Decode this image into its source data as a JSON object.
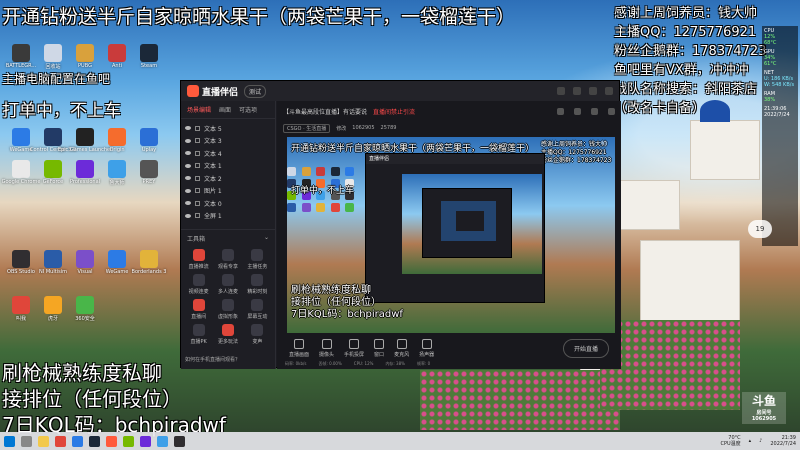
{
  "overlay": {
    "headline": "开通钻粉送半斤自家晾晒水果干（两袋芒果干，一袋榴莲干）",
    "thanks_lines": [
      "感谢上周饲养员：钱大帅",
      "主播QQ：1275776921",
      "粉丝企鹅群：178374723",
      "鱼吧里有VX群，冲冲冲",
      "战队名称搜索：斜阳茶店",
      "（改名卡自备）"
    ],
    "config_note": "主播电脑配置在鱼吧",
    "order_status": "打单中，不上车",
    "bottom_lines": [
      "刷枪械熟练度私聊",
      "接排位（任何段位）",
      "7日KQL码：bchpiradwf"
    ]
  },
  "desktop_icons": [
    {
      "label": "BATTLEGR...",
      "color": "#3a3a3a"
    },
    {
      "label": "回收站",
      "color": "#cfd8e6"
    },
    {
      "label": "PUBG",
      "color": "#d9a13c"
    },
    {
      "label": "Anti",
      "color": "#c93b3b"
    },
    {
      "label": "Steam",
      "color": "#1b2838"
    },
    {
      "label": "WeGame",
      "color": "#2c7be5"
    },
    {
      "label": "Control Center 3.0",
      "color": "#223a66"
    },
    {
      "label": "Epic Games Launcher",
      "color": "#222"
    },
    {
      "label": "Origin",
      "color": "#f56c2d"
    },
    {
      "label": "Uplay",
      "color": "#2b6fd6"
    },
    {
      "label": "Google Chrome",
      "color": "#e9e9e9"
    },
    {
      "label": "GeForce",
      "color": "#76b900"
    },
    {
      "label": "Professional",
      "color": "#6c2bd9"
    },
    {
      "label": "鲁大师",
      "color": "#3ea0e8"
    },
    {
      "label": "PREY",
      "color": "#555"
    },
    {
      "label": "OBS Studio",
      "color": "#302e31"
    },
    {
      "label": "NI Multisim",
      "color": "#2a5ca8"
    },
    {
      "label": "Visual",
      "color": "#7b4fc9"
    },
    {
      "label": "WeGame",
      "color": "#2c7be5"
    },
    {
      "label": "Borderlands 3",
      "color": "#e2b33a"
    },
    {
      "label": "叫我",
      "color": "#e0463a"
    },
    {
      "label": "虎牙",
      "color": "#f5a623"
    },
    {
      "label": "360安全",
      "color": "#49b649"
    }
  ],
  "app": {
    "name": "直播伴侣",
    "version_badge": "测试",
    "tabs": [
      "场景编辑",
      "画面",
      "可选项"
    ],
    "scenes": [
      "文本 5",
      "文本 3",
      "文本 4",
      "文本 1",
      "文本 2",
      "图片 1",
      "文本 0",
      "全屏 1"
    ],
    "tools_title": "工具箱",
    "tools": [
      "直播推流",
      "观看专享",
      "主播任务",
      "视频连麦",
      "多人连麦",
      "精彩时刻",
      "直播间",
      "虚拟形象",
      "屏幕互动",
      "直播PK",
      "更多玩法",
      "变声"
    ],
    "bottom_note": "如何在手机直播间观看？",
    "room_title": "【斗鱼最高段位直播】有话要说",
    "room_prefix": "有话要说",
    "room_tag": "直播间禁止引流",
    "room_meta": [
      "CSGO · 生活直播",
      "修改",
      "1062905",
      "25789"
    ],
    "toolbar": [
      "直播画面",
      "摄像头",
      "手机投屏",
      "窗口",
      "麦克风",
      "扬声器"
    ],
    "start_label": "开始直播",
    "stats": [
      "码率: 0kb/s",
      "丢帧: 0.00%",
      "CPU: 12%",
      "内存: 38%",
      "帧率: 0"
    ]
  },
  "preview": {
    "headline": "开通钻粉送半斤自家晾晒水果干（两袋芒果干，一袋榴莲干）",
    "thanks": [
      "感谢上周饲养员：钱大帅",
      "主播QQ：1275776921",
      "粉丝企鹅群：178374723"
    ],
    "order_status": "打单中，不上车",
    "bottom_lines": [
      "刷枪械熟练度私聊",
      "接排位（任何段位）",
      "7日KQL码：bchpiradwf"
    ],
    "inner_title": "直播伴侣"
  },
  "sys": {
    "cpu_label": "CPU",
    "cpu_values": [
      "12%",
      "68°C"
    ],
    "gpu_label": "GPU",
    "gpu_values": [
      "34%",
      "61°C"
    ],
    "net_label": "NET",
    "net_values": [
      "U: 186 KB/s",
      "W: 548 KB/s"
    ],
    "ram_label": "RAM",
    "ram_values": [
      "38%"
    ],
    "time": "21:39:06",
    "date": "2022/7/24",
    "badge": "19"
  },
  "douyu": {
    "logo": "斗鱼",
    "room_label": "房间号",
    "room_no": "1062905"
  },
  "taskbar": {
    "temp": "70°C",
    "temp_sub": "CPU温度",
    "time": "21:39",
    "date": "2022/7/24"
  }
}
